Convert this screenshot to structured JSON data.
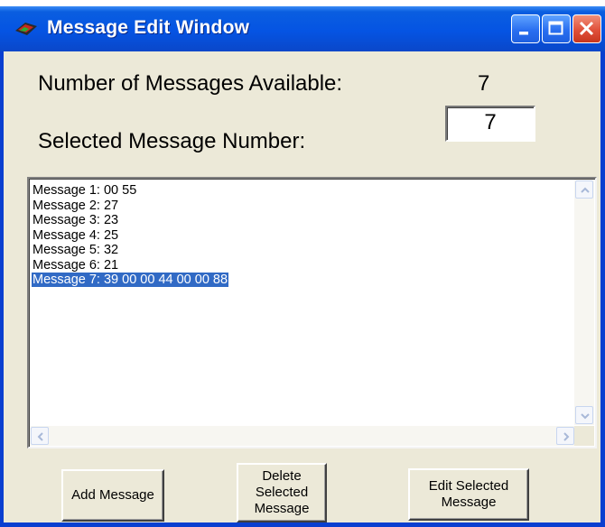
{
  "window": {
    "title": "Message Edit Window"
  },
  "fields": {
    "count_label": "Number of Messages Available:",
    "count_value": "7",
    "selected_label": "Selected Message Number:",
    "selected_value": "7"
  },
  "messages": {
    "selected_index": 6,
    "items": [
      "Message 1: 00 55",
      "Message 2: 27",
      "Message 3: 23",
      "Message 4: 25",
      "Message 5: 32",
      "Message 6: 21",
      "Message 7: 39 00 00 44 00 00 88"
    ]
  },
  "buttons": {
    "add": "Add Message",
    "delete": "Delete Selected Message",
    "edit": "Edit Selected Message"
  },
  "colors": {
    "title_bar": "#0554e3",
    "selection": "#316ac5",
    "dialog_face": "#ece9d8",
    "close_button": "#e0503a"
  },
  "icons": [
    "app-icon",
    "minimize-icon",
    "maximize-icon",
    "close-icon",
    "scroll-up-icon",
    "scroll-down-icon",
    "scroll-left-icon",
    "scroll-right-icon"
  ]
}
